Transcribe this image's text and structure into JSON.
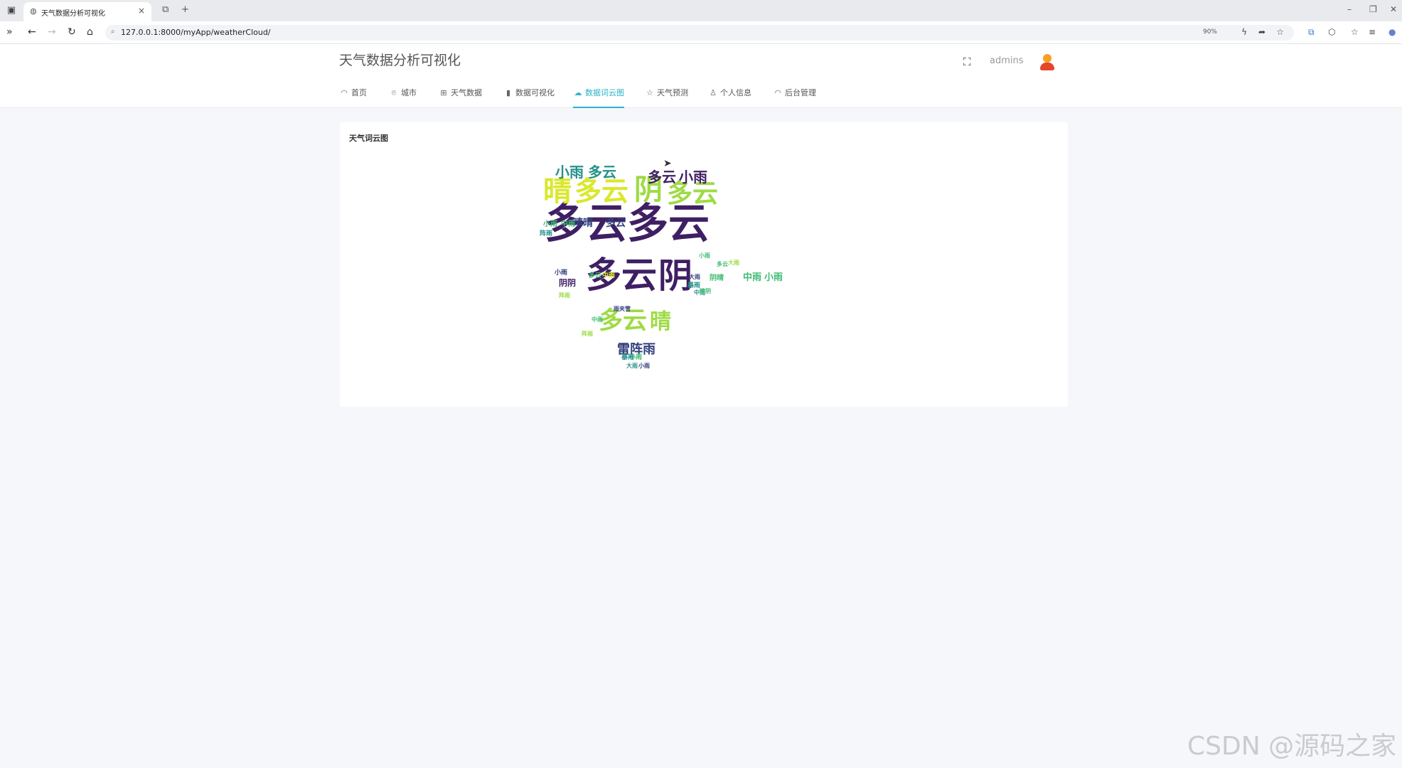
{
  "browser": {
    "tab_title": "天气数据分析可视化",
    "url": "127.0.0.1:8000/myApp/weatherCloud/",
    "zoom": "90%"
  },
  "header": {
    "brand": "天气数据分析可视化",
    "username": "admins"
  },
  "menu": [
    {
      "label": "首页",
      "icon": "dashboard-icon",
      "glyph": "◠"
    },
    {
      "label": "城市",
      "icon": "location-pin-icon",
      "glyph": "⌾"
    },
    {
      "label": "天气数据",
      "icon": "grid-icon",
      "glyph": "⊞"
    },
    {
      "label": "数据可视化",
      "icon": "bar-chart-icon",
      "glyph": "▮"
    },
    {
      "label": "数据词云图",
      "icon": "cloud-icon",
      "glyph": "☁",
      "active": true
    },
    {
      "label": "天气预测",
      "icon": "star-icon",
      "glyph": "☆"
    },
    {
      "label": "个人信息",
      "icon": "user-icon",
      "glyph": "♙"
    },
    {
      "label": "后台管理",
      "icon": "dashboard-icon",
      "glyph": "◠"
    }
  ],
  "card": {
    "title": "天气词云图"
  },
  "wordcloud": {
    "colors": {
      "dark": "#3f1f63",
      "navy": "#34407e",
      "teal": "#26918b",
      "green": "#3fbc73",
      "lime": "#9edb44",
      "yellow": "#d9e82b"
    },
    "words": [
      {
        "text": "多云",
        "color": "dark"
      },
      {
        "text": "多云",
        "color": "dark"
      },
      {
        "text": "多云",
        "color": "dark"
      },
      {
        "text": "阴",
        "color": "dark"
      },
      {
        "text": "晴",
        "color": "yellow"
      },
      {
        "text": "多云",
        "color": "yellow"
      },
      {
        "text": "阴",
        "color": "lime"
      },
      {
        "text": "多云",
        "color": "lime"
      },
      {
        "text": "多云",
        "color": "lime"
      },
      {
        "text": "晴",
        "color": "lime"
      },
      {
        "text": "小雨",
        "color": "teal"
      },
      {
        "text": "多云",
        "color": "teal"
      },
      {
        "text": "多云",
        "color": "dark"
      },
      {
        "text": "小雨",
        "color": "dark"
      },
      {
        "text": "雷阵雨",
        "color": "navy"
      },
      {
        "text": "晴晴",
        "color": "navy"
      },
      {
        "text": "多云",
        "color": "navy"
      },
      {
        "text": "阴阴",
        "color": "dark"
      },
      {
        "text": "中雨",
        "color": "green"
      },
      {
        "text": "小雨",
        "color": "green"
      },
      {
        "text": "小雨",
        "color": "green"
      },
      {
        "text": "中雨",
        "color": "green"
      },
      {
        "text": "阵雨",
        "color": "teal"
      },
      {
        "text": "小雨",
        "color": "navy"
      },
      {
        "text": "暴雨",
        "color": "teal"
      },
      {
        "text": "大雨",
        "color": "navy"
      },
      {
        "text": "中雨",
        "color": "teal"
      },
      {
        "text": "晴阴",
        "color": "green"
      },
      {
        "text": "小雨",
        "color": "green"
      },
      {
        "text": "阵雨",
        "color": "lime"
      },
      {
        "text": "多云",
        "color": "green"
      },
      {
        "text": "中雨",
        "color": "yellow"
      },
      {
        "text": "雨夹雪",
        "color": "navy"
      },
      {
        "text": "阵雨",
        "color": "lime"
      },
      {
        "text": "中雨",
        "color": "green"
      },
      {
        "text": "大雨",
        "color": "teal"
      },
      {
        "text": "小雨",
        "color": "navy"
      },
      {
        "text": "暴雨",
        "color": "teal"
      },
      {
        "text": "阴晴",
        "color": "green"
      },
      {
        "text": "小雨",
        "color": "green"
      },
      {
        "text": "多云",
        "color": "green"
      },
      {
        "text": "大雨",
        "color": "lime"
      }
    ]
  },
  "watermark": "CSDN @源码之家"
}
